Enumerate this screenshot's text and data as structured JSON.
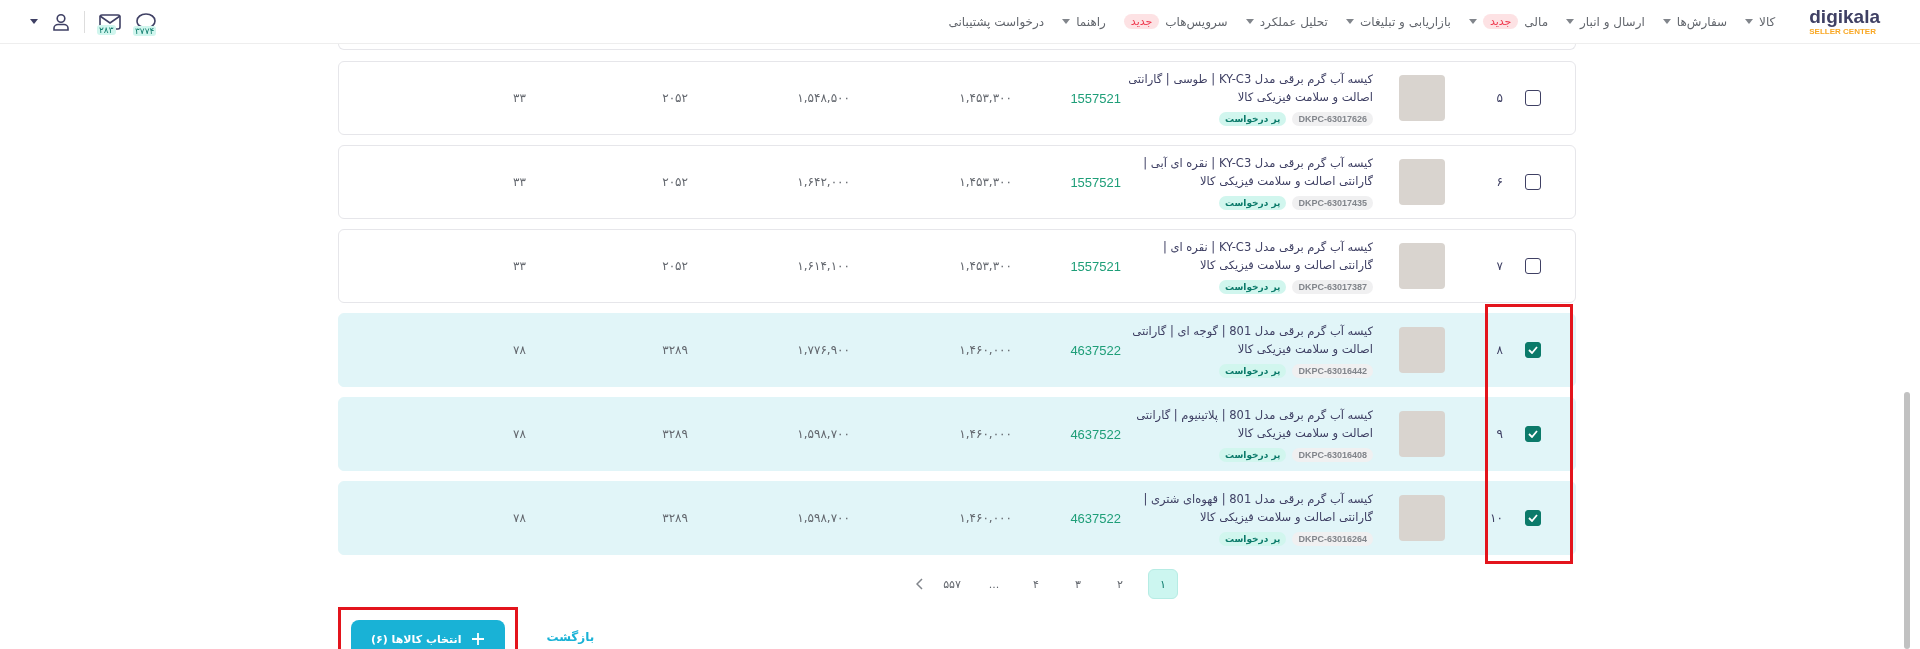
{
  "header": {
    "logo": {
      "name": "digikala",
      "subtitle": "SELLER CENTER"
    },
    "nav": [
      {
        "label": "کالا",
        "caret": true
      },
      {
        "label": "سفارش‌ها",
        "caret": true
      },
      {
        "label": "ارسال و انبار",
        "caret": true
      },
      {
        "label": "مالی",
        "badge": "جدید",
        "caret": true
      },
      {
        "label": "بازاریابی و تبلیغات",
        "caret": true
      },
      {
        "label": "تحلیل عملکرد",
        "caret": true
      },
      {
        "label": "سرویس‌هاب",
        "badge": "جدید",
        "caret": false
      },
      {
        "label": "راهنما",
        "caret": true
      },
      {
        "label": "درخواست پشتیبانی",
        "caret": false
      }
    ],
    "chat_count": "۳۷۷۴",
    "message_count": "۲۸۳"
  },
  "rows": [
    {
      "index": "۵",
      "checked": false,
      "title": "کیسه آب گرم برقی مدل KY-C3 | طوسی | گارانتی اصالت و سلامت فیزیکی کالا",
      "code": "DKPC-63017626",
      "tag": "پر درخواست",
      "product_id": "1557521",
      "price": "۱,۴۵۳,۳۰۰",
      "sale_price": "۱,۵۴۸,۵۰۰",
      "column_8": "۲۰۵۲",
      "column_9": "۳۳"
    },
    {
      "index": "۶",
      "checked": false,
      "title": "کیسه آب گرم برقی مدل KY-C3 | نقره ای آبی | گارانتی اصالت و سلامت فیزیکی کالا",
      "code": "DKPC-63017435",
      "tag": "پر درخواست",
      "product_id": "1557521",
      "price": "۱,۴۵۳,۳۰۰",
      "sale_price": "۱,۶۴۲,۰۰۰",
      "column_8": "۲۰۵۲",
      "column_9": "۳۳"
    },
    {
      "index": "۷",
      "checked": false,
      "title": "کیسه آب گرم برقی مدل KY-C3 | نقره ای | گارانتی اصالت و سلامت فیزیکی کالا",
      "code": "DKPC-63017387",
      "tag": "پر درخواست",
      "product_id": "1557521",
      "price": "۱,۴۵۳,۳۰۰",
      "sale_price": "۱,۶۱۴,۱۰۰",
      "column_8": "۲۰۵۲",
      "column_9": "۳۳"
    },
    {
      "index": "۸",
      "checked": true,
      "title": "کیسه آب گرم برقی مدل 801 | گوجه ای | گارانتی اصالت و سلامت فیزیکی کالا",
      "code": "DKPC-63016442",
      "tag": "پر درخواست",
      "product_id": "4637522",
      "price": "۱,۴۶۰,۰۰۰",
      "sale_price": "۱,۷۷۶,۹۰۰",
      "column_8": "۳۲۸۹",
      "column_9": "۷۸"
    },
    {
      "index": "۹",
      "checked": true,
      "title": "کیسه آب گرم برقی مدل 801 | پلاتینیوم | گارانتی اصالت و سلامت فیزیکی کالا",
      "code": "DKPC-63016408",
      "tag": "پر درخواست",
      "product_id": "4637522",
      "price": "۱,۴۶۰,۰۰۰",
      "sale_price": "۱,۵۹۸,۷۰۰",
      "column_8": "۳۲۸۹",
      "column_9": "۷۸"
    },
    {
      "index": "۱۰",
      "checked": true,
      "title": "کیسه آب گرم برقی مدل 801 | قهوه‌ای شتری | گارانتی اصالت و سلامت فیزیکی کالا",
      "code": "DKPC-63016264",
      "tag": "پر درخواست",
      "product_id": "4637522",
      "price": "۱,۴۶۰,۰۰۰",
      "sale_price": "۱,۵۹۸,۷۰۰",
      "column_8": "۳۲۸۹",
      "column_9": "۷۸"
    }
  ],
  "pagination": {
    "pages": [
      {
        "label": "۱",
        "selected": true
      },
      {
        "label": "۲",
        "selected": false
      },
      {
        "label": "۳",
        "selected": false
      },
      {
        "label": "۴",
        "selected": false
      },
      {
        "label": "...",
        "selected": false
      },
      {
        "label": "۵۵۷",
        "selected": false
      }
    ]
  },
  "select_button": "انتخاب کالاها (۶)",
  "back_link": "بازگشت",
  "highlight_frames": {
    "checkboxes": true,
    "select_button": true
  }
}
